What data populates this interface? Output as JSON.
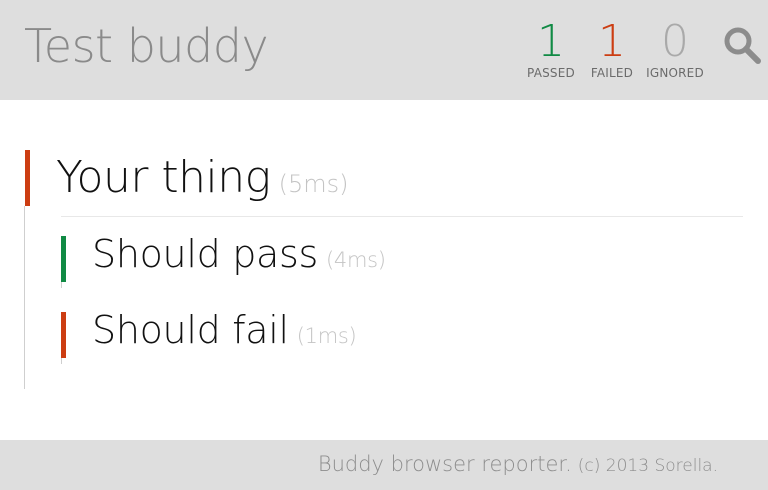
{
  "header": {
    "title": "Test buddy",
    "stats": [
      {
        "count": "1",
        "label": "PASSED",
        "color": "#108a44"
      },
      {
        "count": "1",
        "label": "FAILED",
        "color": "#cc3d12"
      },
      {
        "count": "0",
        "label": "IGNORED",
        "color": "#a9a9a9"
      }
    ],
    "search_icon": "search-icon"
  },
  "suite": {
    "name": "Your thing",
    "duration": "(5ms)",
    "status_color": "#cc3d12",
    "tests": [
      {
        "name": "Should pass",
        "duration": "(4ms)",
        "status_color": "#108a44"
      },
      {
        "name": "Should fail",
        "duration": "(1ms)",
        "status_color": "#cc3d12"
      }
    ]
  },
  "footer": {
    "text": "Buddy browser reporter.",
    "copyright": "(c) 2013 Sorella."
  }
}
